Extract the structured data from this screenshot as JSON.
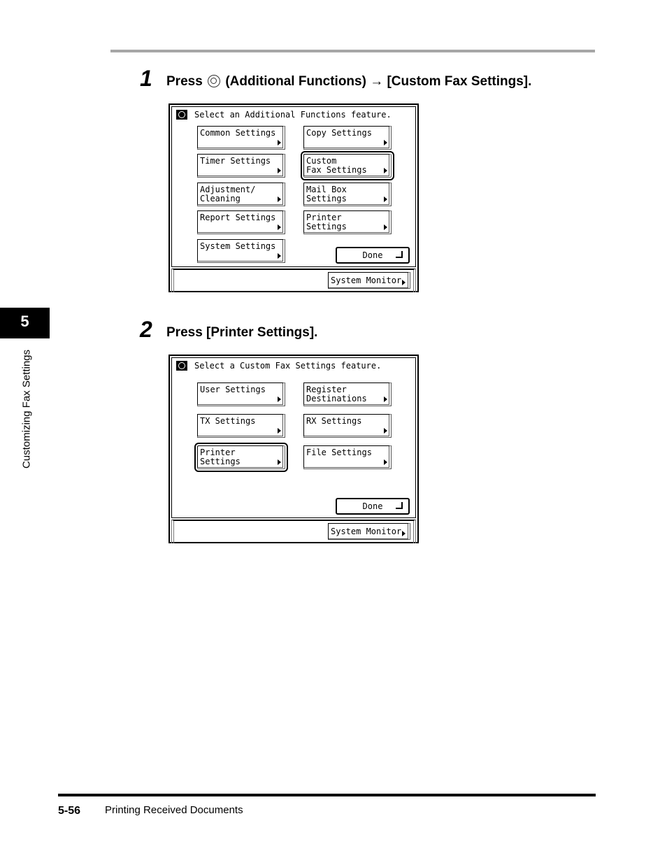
{
  "page": {
    "chapter_number": "5",
    "chapter_title": "Customizing Fax Settings",
    "page_number": "5-56",
    "footer_title": "Printing Received Documents"
  },
  "steps": [
    {
      "number": "1",
      "text_before_icon": "Press",
      "icon": "additional-functions-key-icon",
      "text_after_icon": "(Additional Functions) → [Custom Fax Settings]."
    },
    {
      "number": "2",
      "text": "Press [Printer Settings]."
    }
  ],
  "screen1": {
    "header": "Select an Additional Functions feature.",
    "buttons": [
      {
        "label": "Common Settings"
      },
      {
        "label": "Copy Settings"
      },
      {
        "label": "Timer Settings"
      },
      {
        "label": "Custom\nFax Settings",
        "selected": true
      },
      {
        "label": "Adjustment/\nCleaning"
      },
      {
        "label": "Mail Box Settings"
      },
      {
        "label": "Report Settings"
      },
      {
        "label": "Printer Settings"
      },
      {
        "label": "System Settings"
      }
    ],
    "done_label": "Done",
    "system_monitor_label": "System Monitor"
  },
  "screen2": {
    "header": "Select a Custom Fax Settings feature.",
    "buttons": [
      {
        "label": "User Settings"
      },
      {
        "label": "Register\nDestinations"
      },
      {
        "label": "TX Settings"
      },
      {
        "label": "RX Settings"
      },
      {
        "label": "Printer Settings",
        "selected": true
      },
      {
        "label": "File Settings"
      }
    ],
    "done_label": "Done",
    "system_monitor_label": "System Monitor"
  }
}
